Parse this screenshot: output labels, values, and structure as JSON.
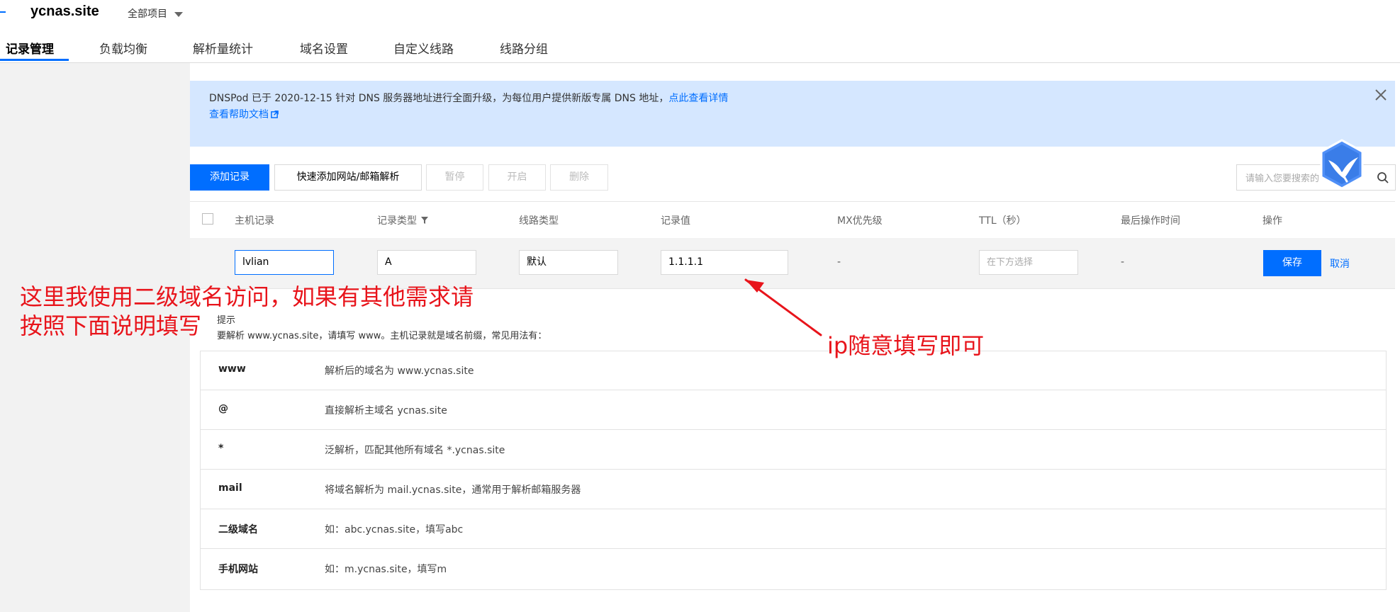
{
  "header": {
    "site_name": "ycnas.site",
    "project_select": "全部项目"
  },
  "tabs": [
    {
      "label": "记录管理",
      "active": true
    },
    {
      "label": "负载均衡"
    },
    {
      "label": "解析量统计"
    },
    {
      "label": "域名设置"
    },
    {
      "label": "自定义线路"
    },
    {
      "label": "线路分组"
    }
  ],
  "notice": {
    "text": "DNSPod 已于 2020-12-15 针对 DNS 服务器地址进行全面升级，为每位用户提供新版专属 DNS 地址，",
    "link": "点此查看详情",
    "help_link": "查看帮助文档"
  },
  "toolbar": {
    "add_record": "添加记录",
    "quick_add": "快速添加网站/邮箱解析",
    "pause": "暂停",
    "enable": "开启",
    "delete": "删除",
    "search_placeholder": "请输入您要搜索的"
  },
  "table": {
    "columns": [
      "主机记录",
      "记录类型",
      "线路类型",
      "记录值",
      "MX优先级",
      "TTL（秒）",
      "最后操作时间",
      "操作"
    ]
  },
  "edit_row": {
    "host": "lvlian",
    "type": "A",
    "line": "默认",
    "value": "1.1.1.1",
    "mx": "-",
    "ttl_placeholder": "在下方选择",
    "last_op": "-",
    "save": "保存",
    "cancel": "取消"
  },
  "hint": {
    "title": "提示",
    "description": "要解析 www.ycnas.site，请填写 www。主机记录就是域名前缀，常见用法有：",
    "rows": [
      {
        "key": "www",
        "value": "解析后的域名为 www.ycnas.site"
      },
      {
        "key": "@",
        "value": "直接解析主域名 ycnas.site"
      },
      {
        "key": "*",
        "value": "泛解析，匹配其他所有域名 *.ycnas.site"
      },
      {
        "key": "mail",
        "value": "将域名解析为 mail.ycnas.site，通常用于解析邮箱服务器"
      },
      {
        "key": "二级域名",
        "value": "如：abc.ycnas.site，填写abc"
      },
      {
        "key": "手机网站",
        "value": "如：m.ycnas.site，填写m"
      }
    ]
  },
  "annotations": {
    "left_line1": "这里我使用二级域名访问，如果有其他需求请",
    "left_line2": "按照下面说明填写",
    "right": "ip随意填写即可",
    "color": "#e8141b"
  },
  "colors": {
    "accent": "#006eff",
    "notice_bg": "#d5e7ff"
  }
}
